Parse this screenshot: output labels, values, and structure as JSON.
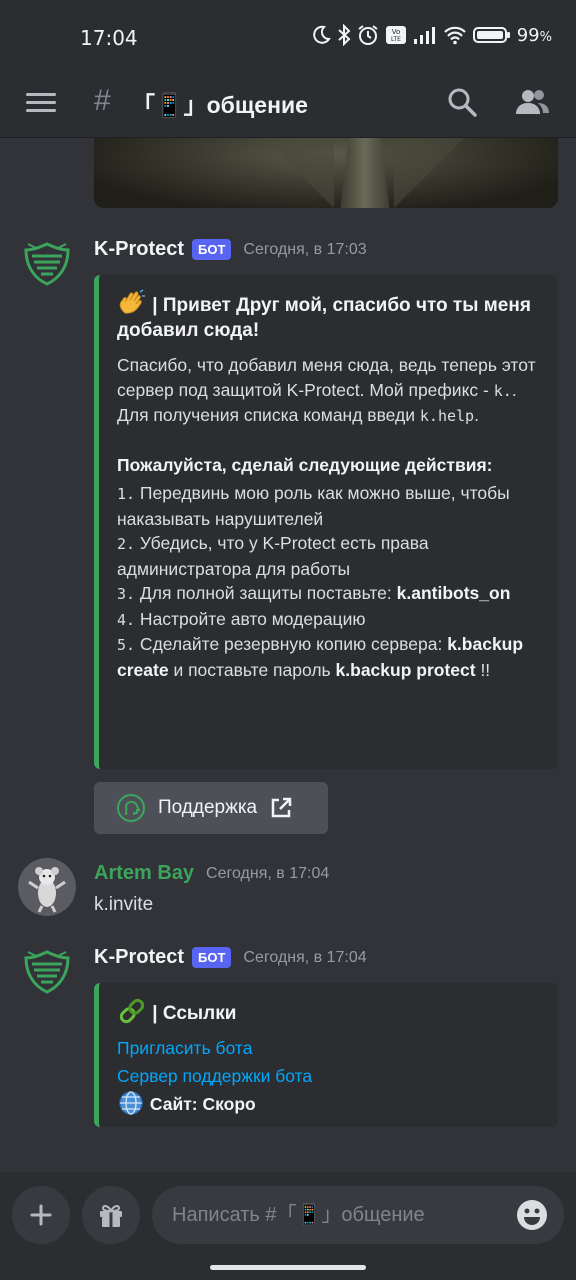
{
  "status": {
    "time": "17:04",
    "battery": "99",
    "battery_suffix": "%"
  },
  "header": {
    "hash": "#",
    "channel": "「📱」общение"
  },
  "messages": [
    {
      "author": "K-Protect",
      "badge": "БОТ",
      "time": "Сегодня, в 17:03",
      "embed": {
        "title_emoji": "👋",
        "title_a": " | Привет ",
        "title_b": "Друг мой",
        "title_c": ", спасибо что ты меня добавил сюда!",
        "p1_a": "Спасибо, что добавил меня сюда, ведь теперь этот сервер под защитой K-Protect. Мой префикс - ",
        "p1_code1": "k.",
        "p1_b": ". Для получения списка команд введи ",
        "p1_code2": "k.help",
        "p1_c": ".",
        "steps_title": "Пожалуйста, сделай следующие действия:",
        "s1_num": "1.",
        "s1_text": " Передвинь мою роль как можно выше, чтобы наказывать нарушителей",
        "s2_num": "2.",
        "s2_text": " Убедись, что у K-Protect есть права администратора для работы",
        "s3_num": "3.",
        "s3_text": " Для полной защиты поставьте: ",
        "s3_bold": "k.antibots_on",
        "s4_num": "4.",
        "s4_text": " Настройте авто модерацию",
        "s5_num": "5.",
        "s5_text": " Сделайте резервную копию сервера: ",
        "s5_bold1": "k.backup create",
        "s5_mid": " и поставьте пароль ",
        "s5_bold2": "k.backup protect",
        "s5_end": " !!"
      },
      "button": "Поддержка"
    },
    {
      "author": "Artem Bay",
      "time": "Сегодня, в 17:04",
      "text": "k.invite"
    },
    {
      "author": "K-Protect",
      "badge": "БОТ",
      "time": "Сегодня, в 17:04",
      "embed": {
        "title_emoji": "🔗",
        "title": " | Ссылки",
        "link1": "Пригласить бота",
        "link2": "Сервер поддержки бота",
        "site_emoji": "🌐",
        "site": " Сайт: Скоро"
      }
    }
  ],
  "composer": {
    "placeholder": "Написать #「📱」общение"
  },
  "colors": {
    "accent": "#5865f2",
    "embed_border": "#3ba55c",
    "link": "#00a8fc"
  }
}
